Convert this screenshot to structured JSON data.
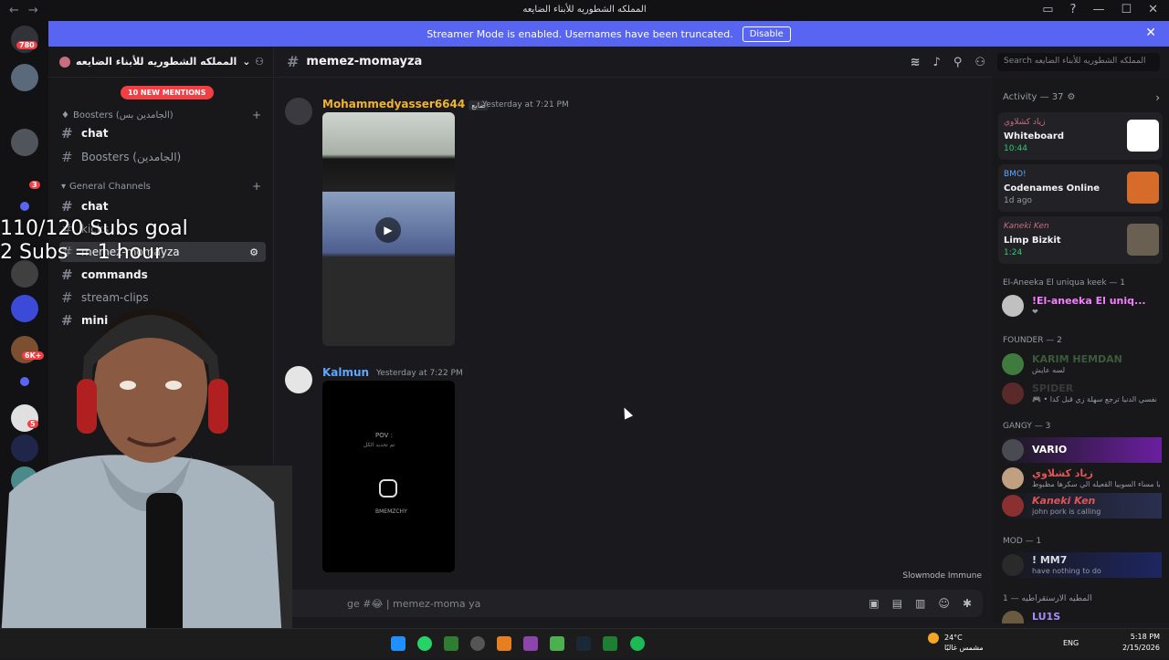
{
  "window": {
    "title": "المملكه الشطوريه للأبناء الضايعه"
  },
  "banner": {
    "text": "Streamer Mode is enabled. Usernames have been truncated.",
    "button": "Disable"
  },
  "servers": {
    "home_badge": "780",
    "badges": [
      "3",
      "4",
      "1",
      "7",
      "6K+",
      "5",
      "61"
    ]
  },
  "sidebar": {
    "server_name": "المملكه الشطوريه للأبناء الضايعه",
    "mentions": "10 NEW MENTIONS",
    "partial_top": "standard",
    "boosters_category": "Boosters (الجامدين بس)",
    "general_category": "General Channels",
    "channels": [
      {
        "name": "chat",
        "style": "bold"
      },
      {
        "name": "Boosters (الجامدين)",
        "style": "muted"
      },
      {
        "name": "chat",
        "style": "bold"
      },
      {
        "name": "kicks",
        "style": "muted"
      },
      {
        "name": "memez-momayza",
        "style": "active"
      },
      {
        "name": "commands",
        "style": "bold"
      },
      {
        "name": "stream-clips",
        "style": "muted"
      },
      {
        "name": "mini",
        "style": "bold"
      }
    ]
  },
  "chat": {
    "channel": "memez-momayza",
    "search_placeholder": "Search المملكه الشطوريه للأبناء الضايعه",
    "messages": [
      {
        "author": "Mohammedyasser6644",
        "tag": "ضايع",
        "time": "Yesterday at 7:21 PM",
        "color": "#f0b232"
      },
      {
        "author": "Kalmun",
        "time": "Yesterday at 7:22 PM",
        "color": "#5ea7ff",
        "embed_text": "POV :",
        "embed_sub": "تم تحديد الكل",
        "embed_handle": "BMEMZCHY"
      }
    ],
    "slowmode": "Slowmode Immune",
    "composer_placeholder": "ge #😂 | memez-moma ya"
  },
  "activity": {
    "header": "Activity — 37",
    "cards": [
      {
        "who": "زياد كشلاوي",
        "game": "Whiteboard",
        "dur": "10:44",
        "thumb": "#ffffff"
      },
      {
        "who": "BMO!",
        "game": "Codenames Online",
        "dur": "1d ago",
        "thumb": "#d66b2a"
      },
      {
        "who": "Kaneki Ken",
        "game": "Limp Bizkit",
        "dur": "1:24",
        "thumb": "#6a6052"
      }
    ]
  },
  "members": {
    "groups": [
      {
        "label": "El-Aneeka El uniqua keek — 1",
        "members": [
          {
            "name": "!El-aneeka El uniq...",
            "status": "❤",
            "color": "#f47fff"
          }
        ]
      },
      {
        "label": "FOUNDER — 2",
        "members": [
          {
            "name": "KARIM HEMDAN",
            "status": "لسه عايش",
            "color": "#3a5a3a"
          },
          {
            "name": "SPIDER",
            "status": "🎮 • نفسي الدنيا ترجع سهلة زي قبل كدا",
            "color": "#3a3a3a"
          }
        ]
      },
      {
        "label": "GANGY — 3",
        "members": [
          {
            "name": "VARIO",
            "status": "",
            "color": "#ffffff"
          },
          {
            "name": "زياد كشلاوي",
            "status": "يا مساء السوبيا القعيله الي سكرها مظبوط",
            "color": "#e05555"
          },
          {
            "name": "Kaneki Ken",
            "status": "john pork is calling",
            "color": "#e05555"
          }
        ]
      },
      {
        "label": "MOD — 1",
        "members": [
          {
            "name": "! MM7",
            "status": "have nothing to do",
            "color": "#dbdee1"
          }
        ]
      },
      {
        "label": "المطيه الارستقراطيه — 1",
        "members": [
          {
            "name": "LU1S",
            "status": "",
            "color": "#a78bfa"
          }
        ]
      }
    ]
  },
  "overlay": {
    "line1": "110/120 Subs goal",
    "line2": "2 Subs = 1 hour"
  },
  "tray": {
    "temp": "24°C",
    "weather": "مشمس غالبًا",
    "lang": "ENG",
    "time": "5:18 PM",
    "date": "2/15/2026"
  }
}
